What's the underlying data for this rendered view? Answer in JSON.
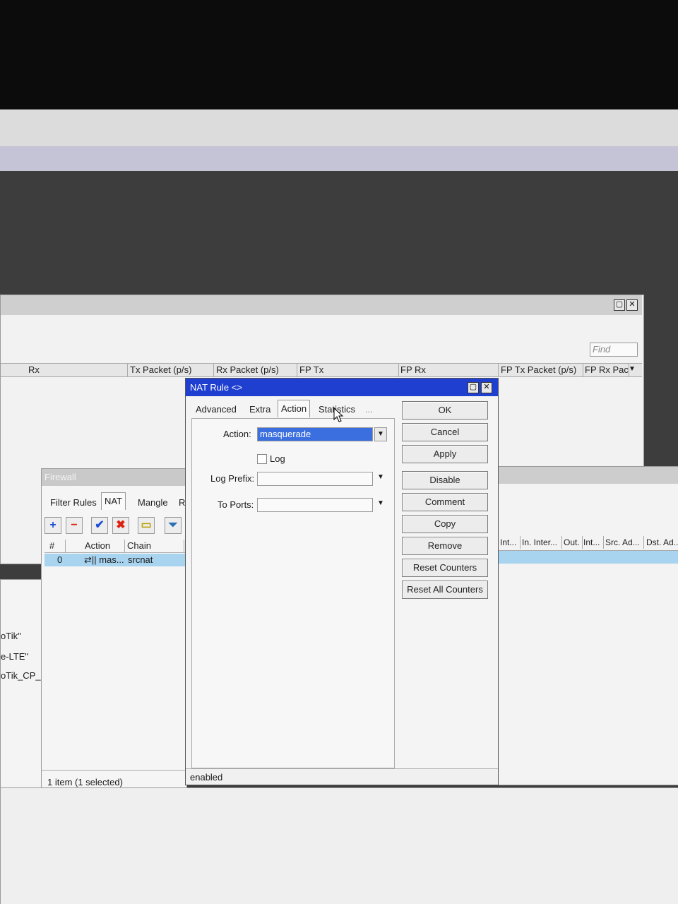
{
  "interfaces": {
    "find_placeholder": "Find",
    "columns": [
      "Rx",
      "Tx Packet (p/s)",
      "Rx Packet (p/s)",
      "FP Tx",
      "FP Rx",
      "FP Tx Packet (p/s)",
      "FP Rx Pac"
    ]
  },
  "left_list": [
    "oTik\"",
    "e-LTE\"",
    "oTik_CP_"
  ],
  "firewall": {
    "title": "Firewall",
    "tabs": [
      "Filter Rules",
      "NAT",
      "Mangle",
      "R"
    ],
    "active_tab": "NAT",
    "columns": [
      "#",
      "Action",
      "Chain"
    ],
    "rows": [
      {
        "num": "0",
        "action": "⇄|| mas...",
        "chain": "srcnat"
      }
    ],
    "status": "1 item (1 selected)",
    "right_columns": [
      "Int...",
      "In. Inter...",
      "Out.",
      "Int...",
      "Src. Ad...",
      "Dst. Ad..."
    ]
  },
  "nat_rule": {
    "title": "NAT Rule <>",
    "tabs": [
      "Advanced",
      "Extra",
      "Action",
      "Statistics",
      "..."
    ],
    "active_tab": "Action",
    "action_label": "Action:",
    "action_value": "masquerade",
    "log_label": "Log",
    "log_prefix_label": "Log Prefix:",
    "to_ports_label": "To Ports:",
    "buttons": [
      "OK",
      "Cancel",
      "Apply",
      "Disable",
      "Comment",
      "Copy",
      "Remove",
      "Reset Counters",
      "Reset All Counters"
    ],
    "status": "enabled"
  },
  "colors": {
    "titlebar_active": "#1f3fd0",
    "selection": "#a8d4f0",
    "dropdown_highlight": "#3b6fe0"
  }
}
